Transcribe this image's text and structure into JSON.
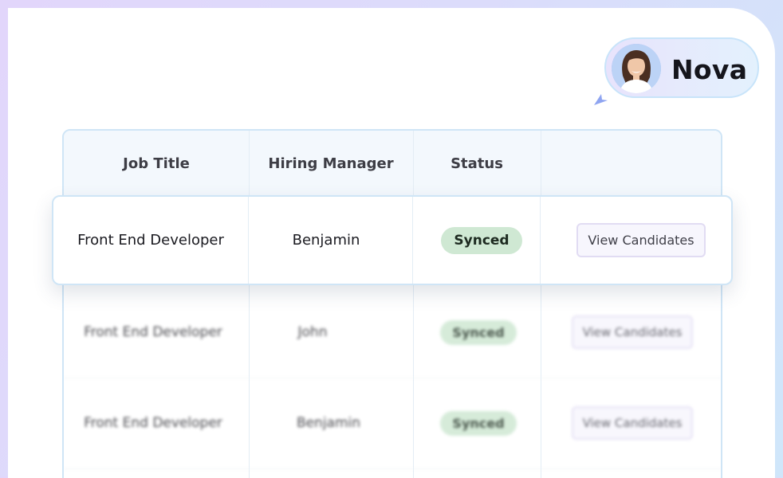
{
  "assistant": {
    "name": "Nova"
  },
  "table": {
    "headers": [
      "Job Title",
      "Hiring Manager",
      "Status",
      ""
    ],
    "highlighted_row": {
      "job_title": "Front End Developer",
      "hiring_manager": "Benjamin",
      "status": "Synced",
      "action": "View Candidates"
    },
    "rows": [
      {
        "job_title": "Front End Developer",
        "hiring_manager": "John",
        "status": "Synced",
        "action": "View Candidates"
      },
      {
        "job_title": "Front End Developer",
        "hiring_manager": "Benjamin",
        "status": "Synced",
        "action": "View Candidates"
      }
    ]
  },
  "colors": {
    "status_synced_bg": "#cfe8d3",
    "border_accent": "#cfe5f6",
    "header_bg": "#f3f8fd"
  }
}
